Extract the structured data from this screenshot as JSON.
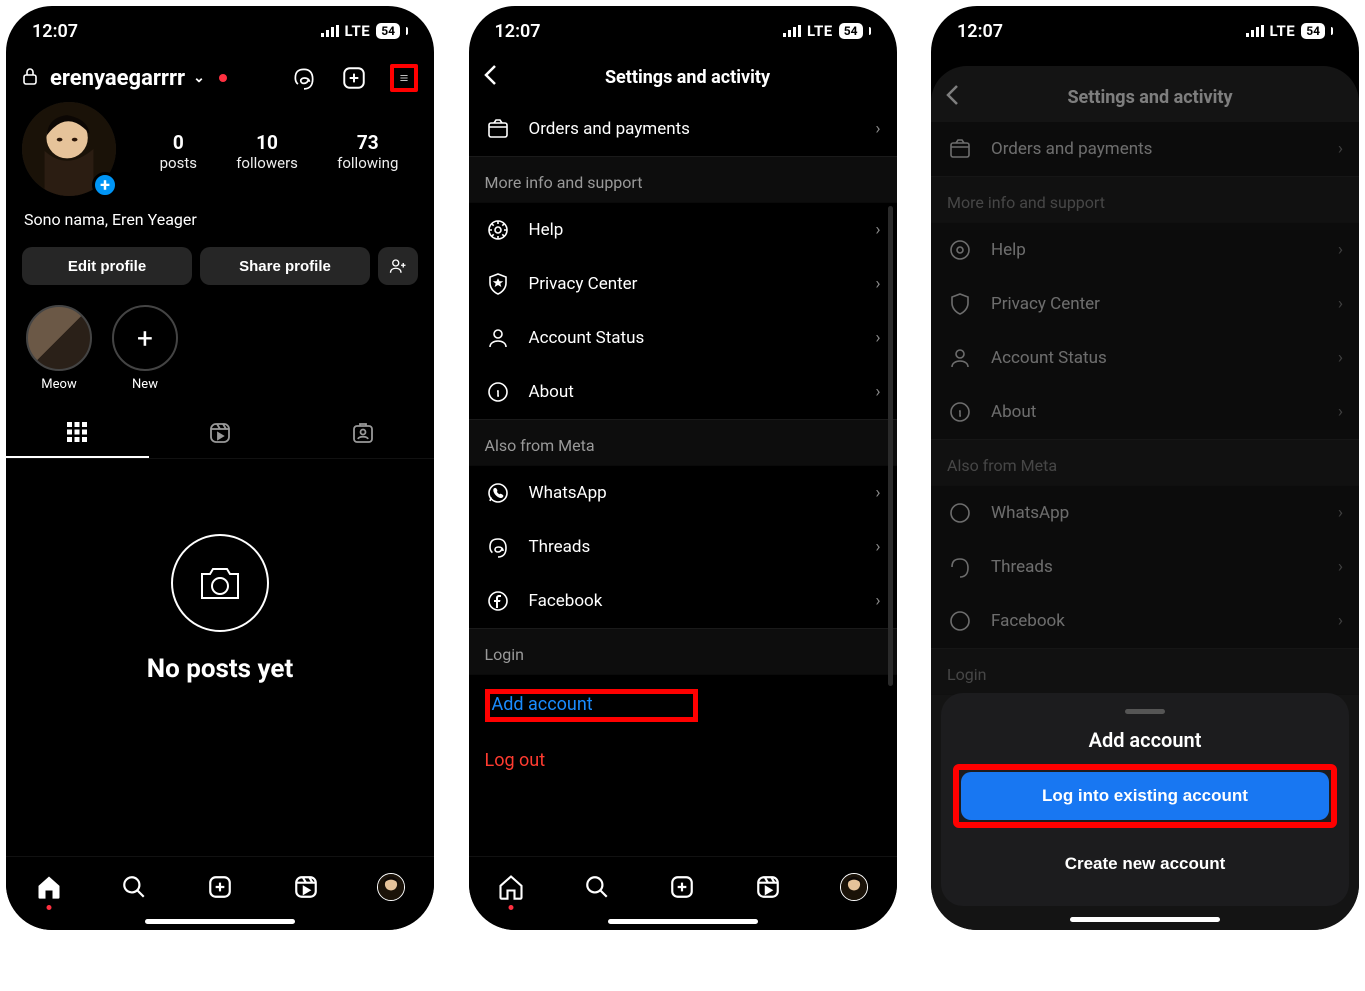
{
  "status": {
    "time": "12:07",
    "network": "LTE",
    "battery": "54"
  },
  "s1": {
    "username": "erenyaegarrrr",
    "stats": {
      "posts_n": "0",
      "posts_l": "posts",
      "followers_n": "10",
      "followers_l": "followers",
      "following_n": "73",
      "following_l": "following"
    },
    "bio": "Sono nama, Eren Yeager",
    "edit": "Edit profile",
    "share": "Share profile",
    "hl_meow": "Meow",
    "hl_new": "New",
    "no_posts": "No posts yet"
  },
  "settings": {
    "title": "Settings and activity",
    "orders": "Orders and payments",
    "section_support": "More info and support",
    "help": "Help",
    "privacy": "Privacy Center",
    "account_status": "Account Status",
    "about": "About",
    "section_meta": "Also from Meta",
    "whatsapp": "WhatsApp",
    "threads": "Threads",
    "facebook": "Facebook",
    "section_login": "Login",
    "add_account": "Add account",
    "logout": "Log out"
  },
  "sheet": {
    "title": "Add account",
    "login": "Log into existing account",
    "create": "Create new account"
  }
}
